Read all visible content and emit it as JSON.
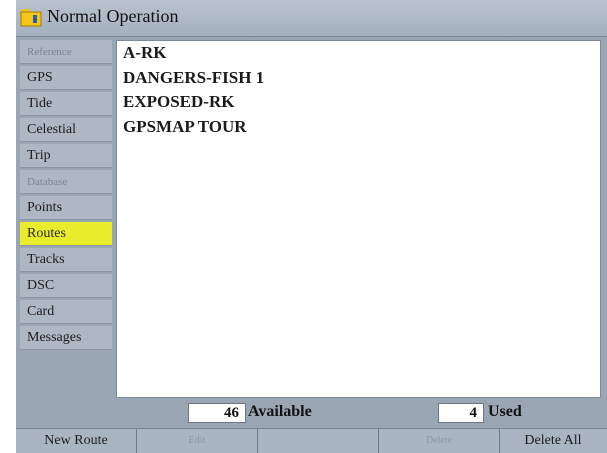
{
  "window": {
    "title": "Normal Operation",
    "icon": "folder-icon"
  },
  "sidebar": {
    "items": [
      {
        "label": "Reference",
        "state": "dim"
      },
      {
        "label": "GPS",
        "state": "normal"
      },
      {
        "label": "Tide",
        "state": "normal"
      },
      {
        "label": "Celestial",
        "state": "normal"
      },
      {
        "label": "Trip",
        "state": "normal"
      },
      {
        "label": "Database",
        "state": "dim"
      },
      {
        "label": "Points",
        "state": "normal"
      },
      {
        "label": "Routes",
        "state": "selected"
      },
      {
        "label": "Tracks",
        "state": "normal"
      },
      {
        "label": "DSC",
        "state": "normal"
      },
      {
        "label": "Card",
        "state": "normal"
      },
      {
        "label": "Messages",
        "state": "normal"
      }
    ]
  },
  "routes": {
    "items": [
      "A-RK",
      "DANGERS-FISH 1",
      "EXPOSED-RK",
      "GPSMAP TOUR"
    ]
  },
  "status": {
    "available_count": "46",
    "available_label": "Available",
    "used_count": "4",
    "used_label": "Used"
  },
  "softkeys": {
    "new_route": "New Route",
    "key2": "Edit",
    "key3": "",
    "key4": "Delete",
    "delete_all": "Delete All"
  },
  "colors": {
    "frame": "#9aa6b4",
    "selected_tab": "#e8ec2a",
    "list_bg": "#ffffff"
  }
}
